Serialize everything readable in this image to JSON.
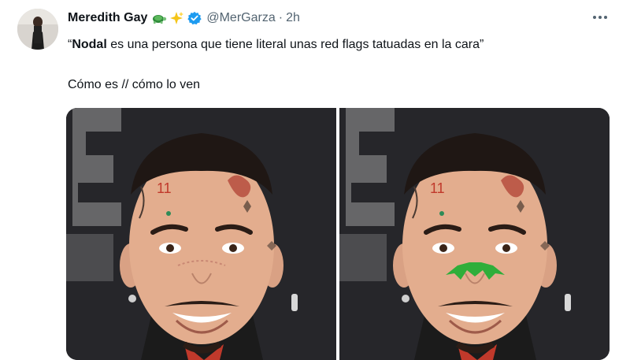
{
  "tweet": {
    "author_name": "Meredith Gay",
    "name_emojis": [
      "turtle-icon",
      "sparkles-icon"
    ],
    "handle": "@MerGarza",
    "separator": "·",
    "time": "2h",
    "quote_open": "“",
    "bold_word": "Nodal",
    "quote_rest": " es una persona que tiene literal unas red flags tatuadas en la cara”",
    "second_line": "Cómo es // cómo lo ven"
  },
  "colors": {
    "text": "#0f1419",
    "secondary": "#536471",
    "verified": "#1d9bf0",
    "background": "#ffffff"
  },
  "media": {
    "images": [
      {
        "content": "face-photo-original"
      },
      {
        "content": "face-photo-green-flags-edited"
      }
    ]
  }
}
